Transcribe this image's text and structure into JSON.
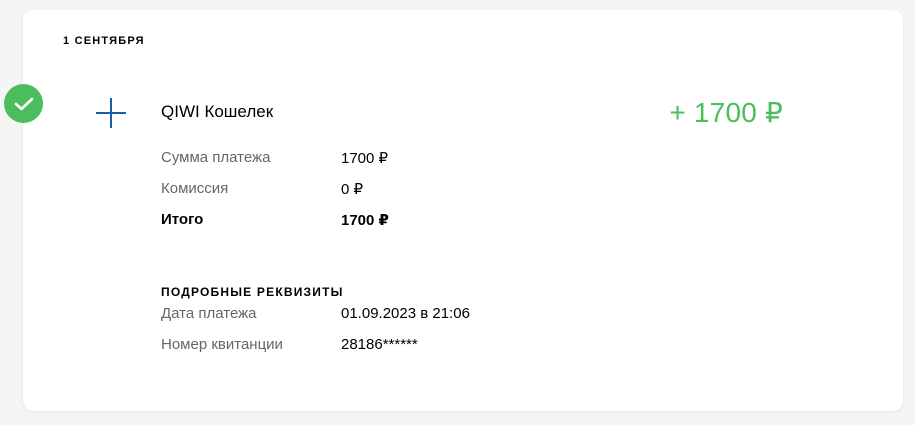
{
  "date_header": "1 СЕНТЯБРЯ",
  "colors": {
    "success": "#4bbd5c",
    "icon_blue": "#1a5ea8"
  },
  "status_icon": "check-icon",
  "provider_icon": "plus-icon",
  "provider_name": "QIWI Кошелек",
  "amount": "+ 1700 ₽",
  "summary": {
    "payment_label": "Сумма платежа",
    "payment_value": "1700 ₽",
    "fee_label": "Комиссия",
    "fee_value": "0 ₽",
    "total_label": "Итого",
    "total_value": "1700 ₽"
  },
  "details": {
    "title": "ПОДРОБНЫЕ РЕКВИЗИТЫ",
    "date_label": "Дата платежа",
    "date_value": "01.09.2023 в 21:06",
    "receipt_label": "Номер квитанции",
    "receipt_value": "28186******"
  }
}
